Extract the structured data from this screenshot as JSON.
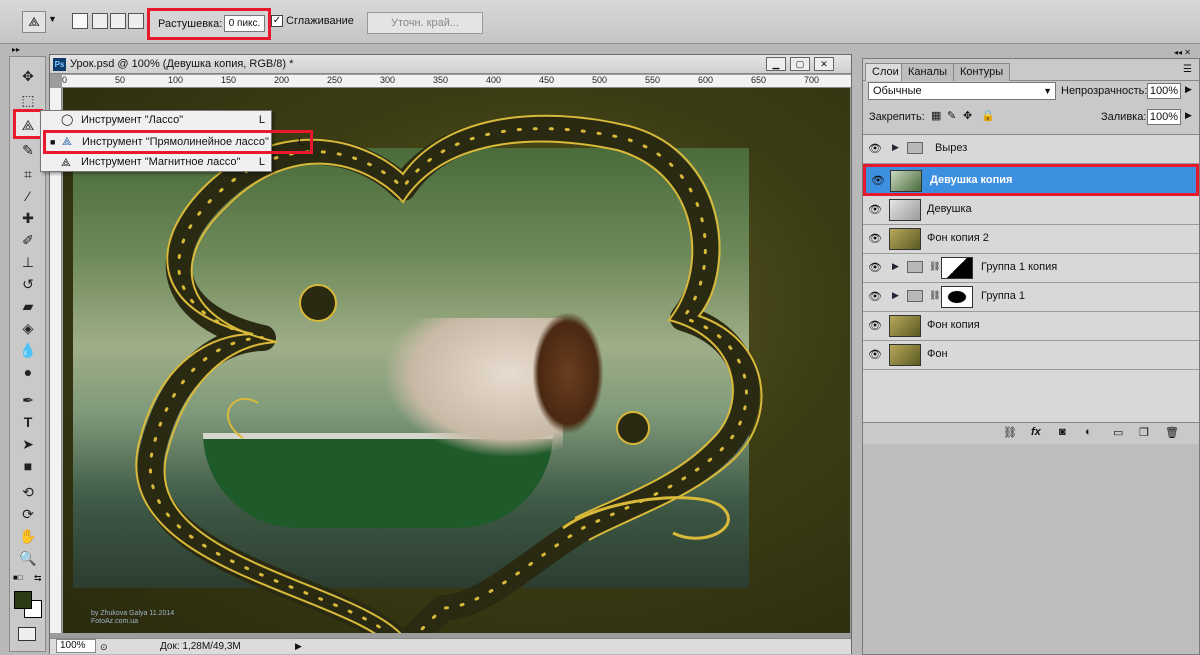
{
  "options_bar": {
    "feather_label": "Растушевка:",
    "feather_value": "0 пикс.",
    "antialias_label": "Сглаживание",
    "antialias_checked": "✓",
    "refine_edge_label": "Уточн. край..."
  },
  "flyout": {
    "items": [
      {
        "label": "Инструмент \"Лассо\"",
        "key": "L"
      },
      {
        "label": "Инструмент \"Прямолинейное лассо\"",
        "key": "L"
      },
      {
        "label": "Инструмент \"Магнитное лассо\"",
        "key": "L"
      }
    ]
  },
  "document": {
    "title": "Урок.psd @ 100% (Девушка копия, RGB/8) *",
    "ps_icon": "Ps",
    "ruler_ticks": [
      "0",
      "50",
      "100",
      "150",
      "200",
      "250",
      "300",
      "350",
      "400",
      "450",
      "500",
      "550",
      "600",
      "650",
      "700"
    ],
    "zoom": "100%",
    "doc_size": "Док: 1,28M/49,3M",
    "watermark": "by Zhukova Galya 11.2014\nFotoAz.com.ua",
    "colors": {
      "frame_gold": "#d8b93a",
      "frame_dark": "#2a2a12"
    }
  },
  "panel": {
    "tabs": [
      "Слои",
      "Каналы",
      "Контуры"
    ],
    "blend_mode": "Обычные",
    "opacity_label": "Непрозрачность:",
    "opacity_value": "100%",
    "lock_label": "Закрепить:",
    "fill_label": "Заливка:",
    "fill_value": "100%",
    "layers": [
      {
        "name": "Вырез",
        "type": "group"
      },
      {
        "name": "Девушка копия",
        "type": "image",
        "selected": true
      },
      {
        "name": "Девушка",
        "type": "image"
      },
      {
        "name": "Фон копия 2",
        "type": "image"
      },
      {
        "name": "Группа 1 копия",
        "type": "group-mask"
      },
      {
        "name": "Группа 1",
        "type": "group-mask"
      },
      {
        "name": "Фон копия",
        "type": "image"
      },
      {
        "name": "Фон",
        "type": "image"
      }
    ],
    "footer_icons": [
      "link-icon",
      "fx-icon",
      "mask-icon",
      "adjustment-icon",
      "folder-icon",
      "new-layer-icon",
      "trash-icon"
    ]
  },
  "accent": {
    "selection": "#3d8fe0",
    "highlight": "#e8192c"
  }
}
